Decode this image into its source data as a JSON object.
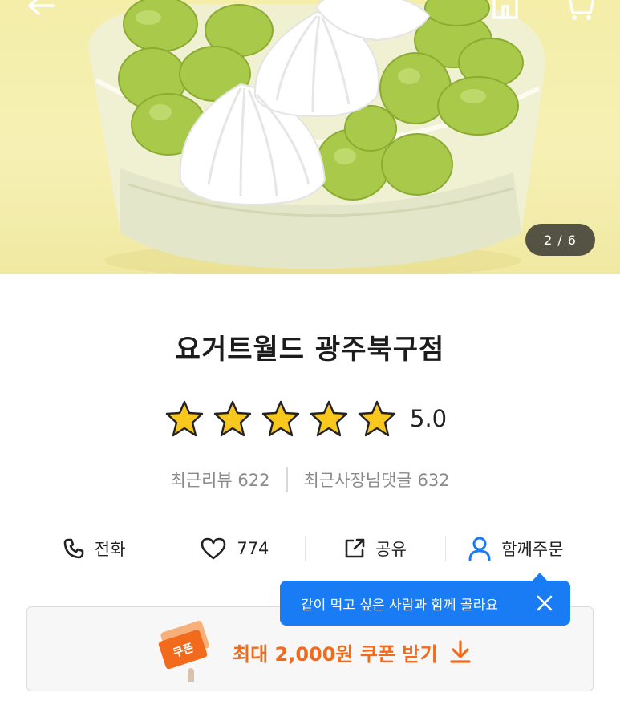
{
  "hero": {
    "counter_current": "2",
    "counter_separator": "/",
    "counter_total": "6"
  },
  "shop": {
    "name": "요거트월드 광주북구점",
    "rating_stars": 5,
    "rating_score": "5.0",
    "recent_reviews_label": "최근리뷰",
    "recent_reviews_count": "622",
    "owner_replies_label": "최근사장님댓글",
    "owner_replies_count": "632"
  },
  "actions": {
    "call_label": "전화",
    "like_count": "774",
    "share_label": "공유",
    "group_order_label": "함께주문"
  },
  "tooltip": {
    "text": "같이 먹고 싶은 사람과 함께 골라요"
  },
  "coupon": {
    "badge_text": "쿠폰",
    "label": "최대 2,000원 쿠폰 받기"
  },
  "colors": {
    "accent_blue": "#1a7cf5",
    "coupon_orange": "#f26b1d",
    "star_yellow": "#f9c81e"
  }
}
